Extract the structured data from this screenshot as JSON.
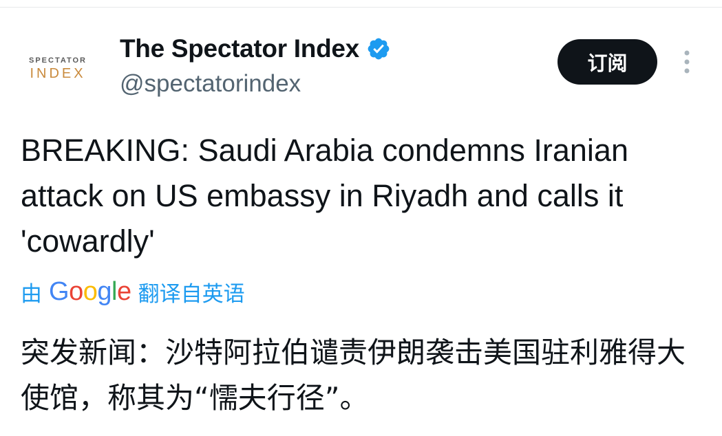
{
  "account": {
    "avatar": {
      "logo_top": "SPECTATOR",
      "logo_bottom": "INDEX"
    },
    "display_name": "The Spectator Index",
    "handle": "@spectatorindex",
    "verified_icon": "verified-badge-icon",
    "verified_color": "#1d9bf0"
  },
  "actions": {
    "subscribe_label": "订阅",
    "more_icon": "vertical-ellipsis-icon"
  },
  "tweet": {
    "text": "BREAKING: Saudi Arabia condemns Iranian attack on US embassy in Riyadh and calls it 'cowardly'",
    "translation": {
      "prefix": "由",
      "provider": "Google",
      "suffix": "翻译自英语",
      "link_color": "#1d9bf0"
    },
    "translated_text": "突发新闻：沙特阿拉伯谴责伊朗袭击美国驻利雅得大使馆，称其为“懦夫行径”。"
  }
}
